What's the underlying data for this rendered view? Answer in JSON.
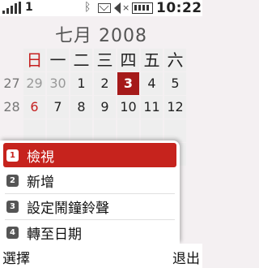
{
  "status_bar": {
    "line_indicator": "1",
    "time": "10:22",
    "icons": [
      "signal-icon",
      "bluetooth-icon",
      "mail-icon",
      "mute-icon",
      "battery-icon"
    ]
  },
  "calendar": {
    "month_title": "七月 2008",
    "weekday_headers": [
      "日",
      "一",
      "二",
      "三",
      "四",
      "五",
      "六"
    ],
    "weeks": [
      {
        "week": "27",
        "days": [
          "29",
          "30",
          "1",
          "2",
          "3",
          "4",
          "5"
        ]
      },
      {
        "week": "28",
        "days": [
          "6",
          "7",
          "8",
          "9",
          "10",
          "11",
          "12"
        ]
      }
    ],
    "today": "3",
    "accent_color": "#a51a1a"
  },
  "menu": {
    "items": [
      {
        "num": "1",
        "label": "檢視"
      },
      {
        "num": "2",
        "label": "新增"
      },
      {
        "num": "3",
        "label": "設定鬧鐘鈴聲"
      },
      {
        "num": "4",
        "label": "轉至日期"
      }
    ],
    "selected_index": 0,
    "highlight_color": "#c6231d"
  },
  "softkeys": {
    "left": "選擇",
    "right": "退出"
  }
}
